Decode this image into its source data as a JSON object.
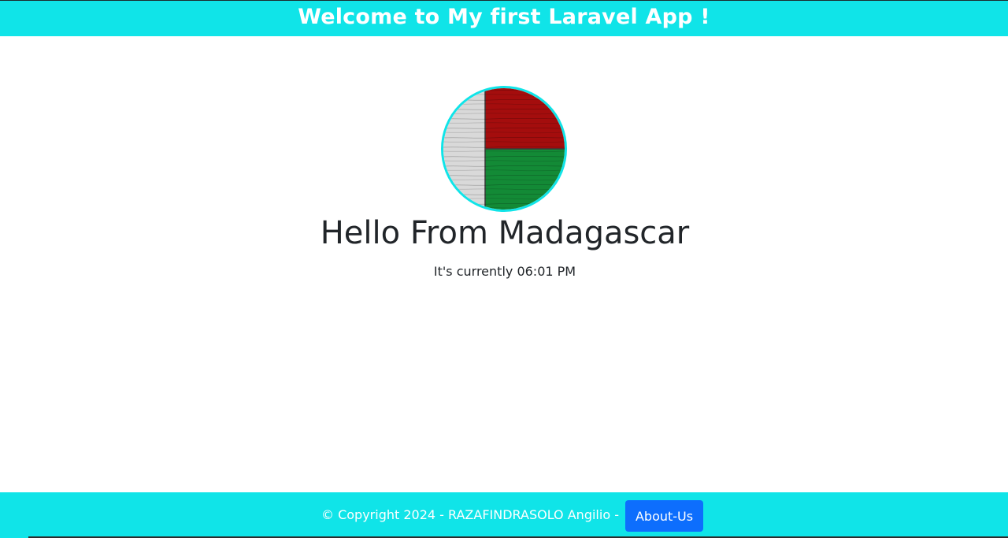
{
  "header": {
    "title": "Welcome to My first Laravel App !"
  },
  "main": {
    "flag_image": {
      "icon": "madagascar-flag",
      "colors": {
        "white": "#d9d9d9",
        "red": "#a40d0d",
        "green": "#138a36"
      }
    },
    "heading": "Hello From Madagascar",
    "time_text": "It's currently 06:01 PM"
  },
  "footer": {
    "copyright": "© Copyright 2024 - RAZAFINDRASOLO Angilio -",
    "about_label": "About-Us"
  },
  "theme": {
    "accent": "#10e4e8",
    "button": "#0d6efd",
    "text": "#212529"
  }
}
